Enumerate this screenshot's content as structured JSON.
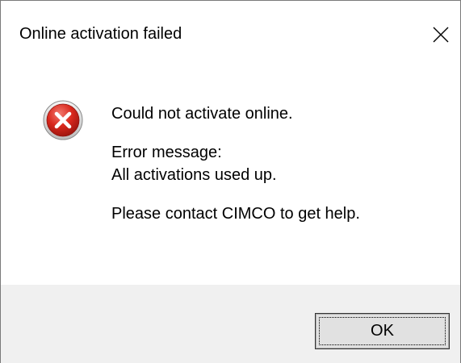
{
  "window": {
    "title": "Online activation failed",
    "close_icon": "close-icon"
  },
  "message": {
    "icon": "error-icon",
    "headline": "Could not activate online.",
    "error_label": "Error message:",
    "error_detail": "All activations used up.",
    "help_text": "Please contact CIMCO to get help."
  },
  "buttons": {
    "ok_label": "OK"
  },
  "colors": {
    "error_red": "#d9281d",
    "button_face": "#e1e1e1",
    "footer_bg": "#f0f0f0"
  }
}
